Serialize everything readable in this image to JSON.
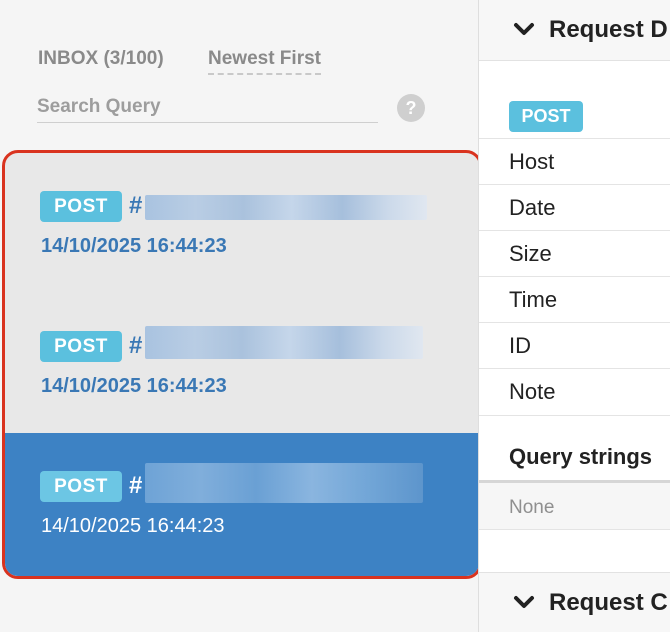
{
  "inbox": {
    "label": "INBOX (3/100)",
    "sort_label": "Newest First",
    "search_placeholder": "Search Query",
    "help_glyph": "?",
    "requests": [
      {
        "method": "POST",
        "hash": "#",
        "timestamp": "14/10/2025 16:44:23",
        "selected": false
      },
      {
        "method": "POST",
        "hash": "#",
        "timestamp": "14/10/2025 16:44:23",
        "selected": false
      },
      {
        "method": "POST",
        "hash": "#",
        "timestamp": "14/10/2025 16:44:23",
        "selected": true
      }
    ]
  },
  "details": {
    "section_title": "Request D",
    "method": "POST",
    "fields": [
      "Host",
      "Date",
      "Size",
      "Time",
      "ID",
      "Note"
    ],
    "query_strings_title": "Query strings",
    "query_strings_value": "None",
    "second_section_title": "Request C"
  },
  "colors": {
    "selected": "#3d82c4",
    "badge": "#5bc0de",
    "highlight_border": "#d9331f",
    "link": "#3a78b5"
  },
  "icons": {
    "help": "help-icon",
    "chevron": "chevron-down-icon"
  }
}
